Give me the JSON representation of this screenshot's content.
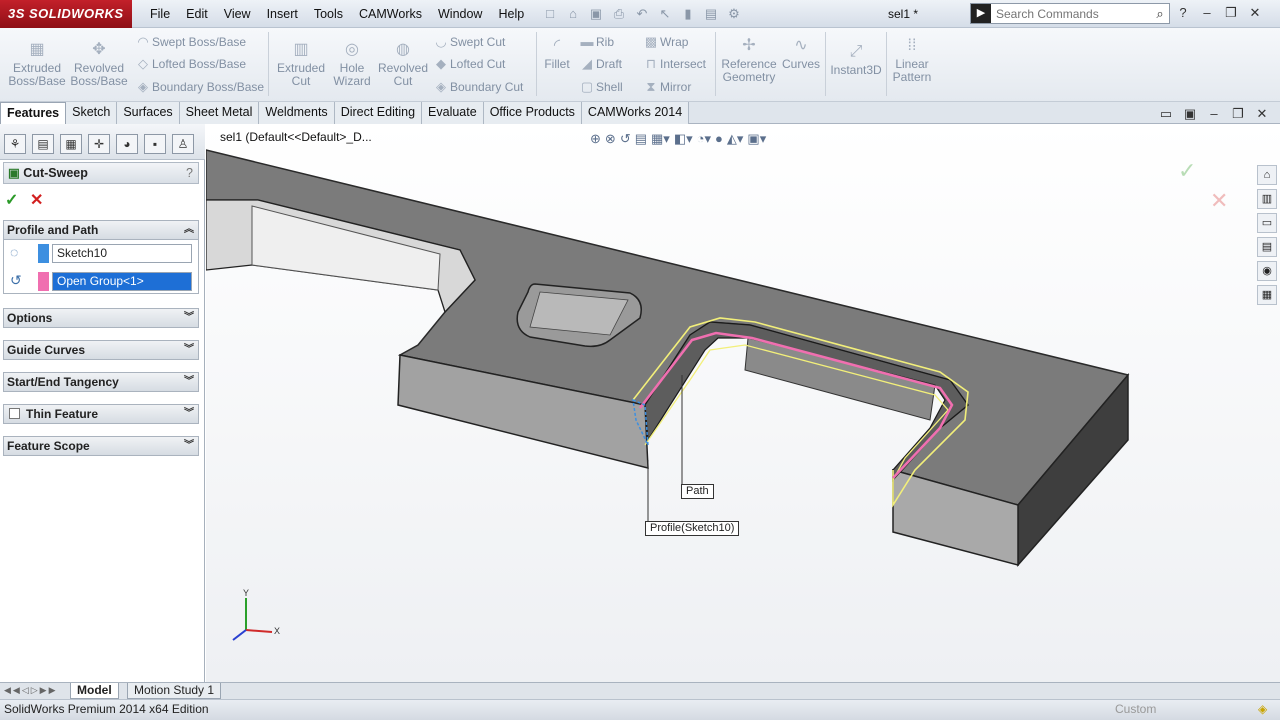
{
  "app": {
    "logo": "3S SOLIDWORKS",
    "doc_title": "sel1 *"
  },
  "menu": [
    "File",
    "Edit",
    "View",
    "Insert",
    "Tools",
    "CAMWorks",
    "Window",
    "Help"
  ],
  "search": {
    "placeholder": "Search Commands"
  },
  "ribbon": {
    "extruded_boss": "Extruded Boss/Base",
    "revolved_boss": "Revolved Boss/Base",
    "swept_boss": "Swept Boss/Base",
    "lofted_boss": "Lofted Boss/Base",
    "boundary_boss": "Boundary Boss/Base",
    "extruded_cut": "Extruded Cut",
    "hole_wizard": "Hole Wizard",
    "revolved_cut": "Revolved Cut",
    "swept_cut": "Swept Cut",
    "lofted_cut": "Lofted Cut",
    "boundary_cut": "Boundary Cut",
    "fillet": "Fillet",
    "rib": "Rib",
    "draft": "Draft",
    "shell": "Shell",
    "wrap": "Wrap",
    "intersect": "Intersect",
    "mirror": "Mirror",
    "reference_geometry": "Reference Geometry",
    "curves": "Curves",
    "instant3d": "Instant3D",
    "linear_pattern": "Linear Pattern"
  },
  "tabs": [
    "Features",
    "Sketch",
    "Surfaces",
    "Sheet Metal",
    "Weldments",
    "Direct Editing",
    "Evaluate",
    "Office Products",
    "CAMWorks 2014"
  ],
  "property_manager": {
    "title": "Cut-Sweep",
    "help": "?",
    "profile_and_path": "Profile and Path",
    "profile_value": "Sketch10",
    "path_value": "Open Group<1>",
    "groups": [
      "Options",
      "Guide Curves",
      "Start/End Tangency",
      "Thin Feature",
      "Feature Scope"
    ]
  },
  "viewport": {
    "breadcrumb": "sel1  (Default<<Default>_D...",
    "callout_path": "Path",
    "callout_profile": "Profile(Sketch10)",
    "axis_x": "X",
    "axis_y": "Y"
  },
  "bottom_tabs": [
    "Model",
    "Motion Study 1"
  ],
  "status": {
    "text": "SolidWorks Premium 2014 x64 Edition",
    "right": "Custom"
  },
  "colors": {
    "path_highlight": "#f06fb0",
    "profile_blue": "#3d8fe0",
    "preview_yellow": "#f2ef7a"
  }
}
